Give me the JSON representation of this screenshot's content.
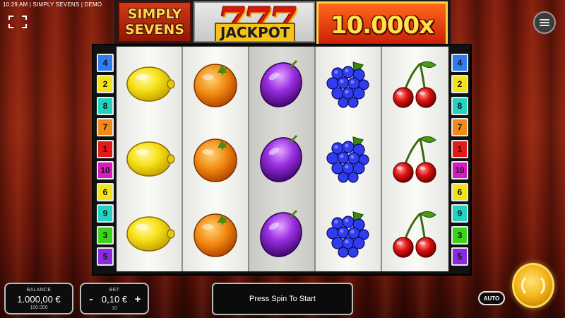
{
  "status_bar": {
    "text": "10:29 AM | SIMPLY SEVENS | DEMO"
  },
  "header": {
    "logo_line1": "SIMPLY",
    "logo_line2": "SEVENS",
    "jackpot_sevens": "777",
    "jackpot_label": "JACKPOT",
    "multiplier": "10.000x"
  },
  "paylines": {
    "left": [
      {
        "number": "4",
        "color": "#2f7cf0"
      },
      {
        "number": "2",
        "color": "#f2e21a"
      },
      {
        "number": "8",
        "color": "#22d4c0"
      },
      {
        "number": "7",
        "color": "#f28a1a"
      },
      {
        "number": "1",
        "color": "#e21a1a"
      },
      {
        "number": "10",
        "color": "#d81ac0"
      },
      {
        "number": "6",
        "color": "#f2e21a"
      },
      {
        "number": "9",
        "color": "#22d4c0"
      },
      {
        "number": "3",
        "color": "#3cd41a"
      },
      {
        "number": "5",
        "color": "#8a2ae2"
      }
    ],
    "right": [
      {
        "number": "4",
        "color": "#2f7cf0"
      },
      {
        "number": "2",
        "color": "#f2e21a"
      },
      {
        "number": "8",
        "color": "#22d4c0"
      },
      {
        "number": "7",
        "color": "#f28a1a"
      },
      {
        "number": "1",
        "color": "#e21a1a"
      },
      {
        "number": "10",
        "color": "#d81ac0"
      },
      {
        "number": "6",
        "color": "#f2e21a"
      },
      {
        "number": "9",
        "color": "#22d4c0"
      },
      {
        "number": "3",
        "color": "#3cd41a"
      },
      {
        "number": "5",
        "color": "#8a2ae2"
      }
    ]
  },
  "reels": [
    {
      "symbol": "lemon",
      "shade": "light"
    },
    {
      "symbol": "orange",
      "shade": "light"
    },
    {
      "symbol": "plum",
      "shade": "dark"
    },
    {
      "symbol": "grapes",
      "shade": "light"
    },
    {
      "symbol": "cherry",
      "shade": "light"
    }
  ],
  "balance": {
    "title": "BALANCE",
    "value": "1.000,00 €",
    "sub": "100.000"
  },
  "bet": {
    "title": "BET",
    "minus": "-",
    "value": "0,10 €",
    "plus": "+",
    "sub": "10"
  },
  "message": "Press Spin To Start",
  "auto_label": "AUTO",
  "icons": {
    "fullscreen": "fullscreen-icon",
    "menu": "menu-icon",
    "spin": "spin-icon"
  },
  "colors": {
    "curtain": "#8e2510",
    "gold": "#f5b71a",
    "panel_border": "#bdbdbd"
  }
}
